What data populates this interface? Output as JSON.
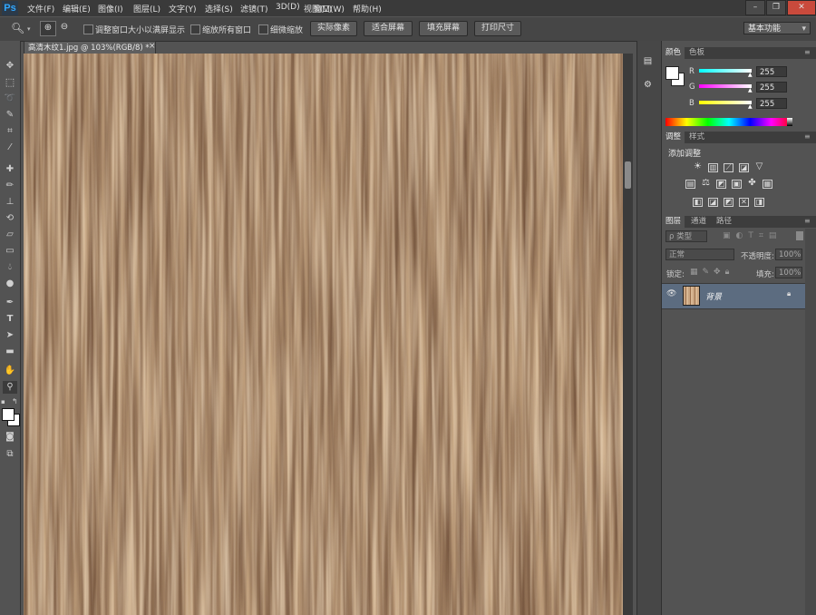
{
  "app": {
    "logo": "Ps"
  },
  "menu": [
    "文件(F)",
    "编辑(E)",
    "图像(I)",
    "图层(L)",
    "文字(Y)",
    "选择(S)",
    "滤镜(T)",
    "3D(D)",
    "视图(V)",
    "窗口(W)",
    "帮助(H)"
  ],
  "window_controls": {
    "minimize": "–",
    "restore": "❐",
    "close": "✕"
  },
  "options_bar": {
    "resize_windows": "调整窗口大小以满屏显示",
    "zoom_all": "缩放所有窗口",
    "scrubby_zoom": "细微缩放",
    "actual_pixels": "实际像素",
    "fit_screen": "适合屏幕",
    "fill_screen": "填充屏幕",
    "print_size": "打印尺寸",
    "workspace": "基本功能"
  },
  "document": {
    "tab_title": "高清木纹1.jpg @ 103%(RGB/8) *",
    "close": "×"
  },
  "color_panel": {
    "tabs": [
      "颜色",
      "色板"
    ],
    "channels": [
      {
        "name": "R",
        "value": "255",
        "color": "#00e5e5"
      },
      {
        "name": "G",
        "value": "255",
        "color": "#e040e0"
      },
      {
        "name": "B",
        "value": "255",
        "color": "#e8e820"
      }
    ]
  },
  "adjustments_panel": {
    "tabs": [
      "调整",
      "样式"
    ],
    "title": "添加调整"
  },
  "layers_panel": {
    "tabs": [
      "图层",
      "通道",
      "路径"
    ],
    "filter_kind": "ρ 类型",
    "blend_mode": "正常",
    "opacity_label": "不透明度:",
    "opacity_value": "100%",
    "lock_label": "锁定:",
    "fill_label": "填充:",
    "fill_value": "100%",
    "layers": [
      {
        "name": "背景",
        "visible": true,
        "locked": true
      }
    ]
  },
  "colors": {
    "layer_selected": "#5c6c80",
    "wood_light": "#e0c3a0",
    "wood_dark": "#6b4a33"
  }
}
